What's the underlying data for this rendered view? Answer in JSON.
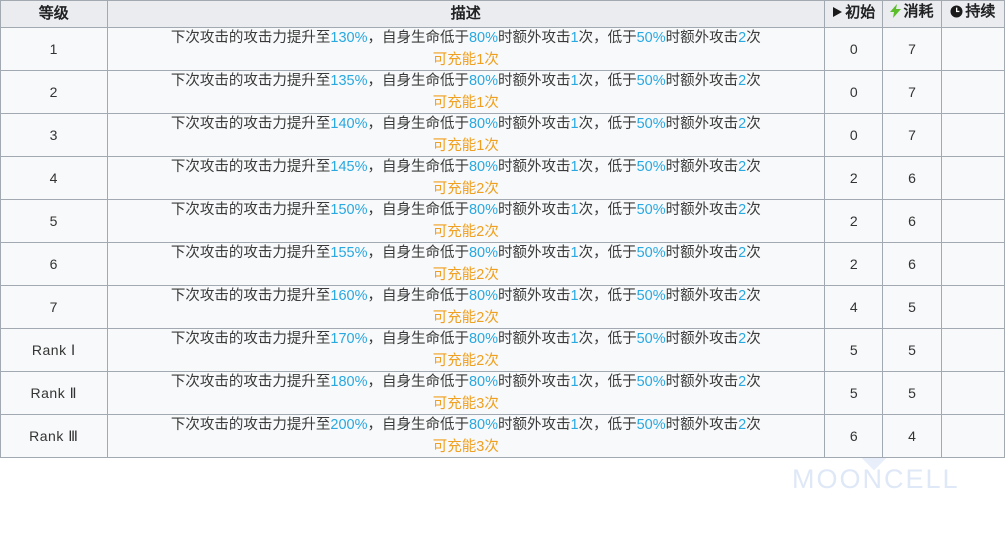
{
  "table": {
    "headers": {
      "level": "等级",
      "description": "描述",
      "initial": "初始",
      "cost": "消耗",
      "duration": "持续"
    },
    "header_icons": {
      "initial": "play-triangle-icon",
      "cost": "lightning-bolt-icon",
      "duration": "clock-icon"
    },
    "colors": {
      "highlight": "#29a8e0",
      "charge": "#f0a020",
      "header_bg": "#eaecf0",
      "row_bg": "#f8f9fa",
      "border": "#a2a9b1",
      "watermark": "#dfe8f7"
    },
    "rows": [
      {
        "level": "1",
        "desc_prefix": "下次攻击的攻击力提升至",
        "atk": "130%",
        "desc_mid1": "，自身生命低于",
        "hp1": "80%",
        "desc_mid2": "时额外攻击",
        "extra1": "1",
        "desc_mid3": "次，低于",
        "hp2": "50%",
        "desc_mid4": "时额外攻击",
        "extra2": "2",
        "desc_suffix": "次",
        "charge": "可充能1次",
        "initial": "0",
        "cost": "7",
        "duration": ""
      },
      {
        "level": "2",
        "desc_prefix": "下次攻击的攻击力提升至",
        "atk": "135%",
        "desc_mid1": "，自身生命低于",
        "hp1": "80%",
        "desc_mid2": "时额外攻击",
        "extra1": "1",
        "desc_mid3": "次，低于",
        "hp2": "50%",
        "desc_mid4": "时额外攻击",
        "extra2": "2",
        "desc_suffix": "次",
        "charge": "可充能1次",
        "initial": "0",
        "cost": "7",
        "duration": ""
      },
      {
        "level": "3",
        "desc_prefix": "下次攻击的攻击力提升至",
        "atk": "140%",
        "desc_mid1": "，自身生命低于",
        "hp1": "80%",
        "desc_mid2": "时额外攻击",
        "extra1": "1",
        "desc_mid3": "次，低于",
        "hp2": "50%",
        "desc_mid4": "时额外攻击",
        "extra2": "2",
        "desc_suffix": "次",
        "charge": "可充能1次",
        "initial": "0",
        "cost": "7",
        "duration": ""
      },
      {
        "level": "4",
        "desc_prefix": "下次攻击的攻击力提升至",
        "atk": "145%",
        "desc_mid1": "，自身生命低于",
        "hp1": "80%",
        "desc_mid2": "时额外攻击",
        "extra1": "1",
        "desc_mid3": "次，低于",
        "hp2": "50%",
        "desc_mid4": "时额外攻击",
        "extra2": "2",
        "desc_suffix": "次",
        "charge": "可充能2次",
        "initial": "2",
        "cost": "6",
        "duration": ""
      },
      {
        "level": "5",
        "desc_prefix": "下次攻击的攻击力提升至",
        "atk": "150%",
        "desc_mid1": "，自身生命低于",
        "hp1": "80%",
        "desc_mid2": "时额外攻击",
        "extra1": "1",
        "desc_mid3": "次，低于",
        "hp2": "50%",
        "desc_mid4": "时额外攻击",
        "extra2": "2",
        "desc_suffix": "次",
        "charge": "可充能2次",
        "initial": "2",
        "cost": "6",
        "duration": ""
      },
      {
        "level": "6",
        "desc_prefix": "下次攻击的攻击力提升至",
        "atk": "155%",
        "desc_mid1": "，自身生命低于",
        "hp1": "80%",
        "desc_mid2": "时额外攻击",
        "extra1": "1",
        "desc_mid3": "次，低于",
        "hp2": "50%",
        "desc_mid4": "时额外攻击",
        "extra2": "2",
        "desc_suffix": "次",
        "charge": "可充能2次",
        "initial": "2",
        "cost": "6",
        "duration": ""
      },
      {
        "level": "7",
        "desc_prefix": "下次攻击的攻击力提升至",
        "atk": "160%",
        "desc_mid1": "，自身生命低于",
        "hp1": "80%",
        "desc_mid2": "时额外攻击",
        "extra1": "1",
        "desc_mid3": "次，低于",
        "hp2": "50%",
        "desc_mid4": "时额外攻击",
        "extra2": "2",
        "desc_suffix": "次",
        "charge": "可充能2次",
        "initial": "4",
        "cost": "5",
        "duration": ""
      },
      {
        "level": "Rank Ⅰ",
        "desc_prefix": "下次攻击的攻击力提升至",
        "atk": "170%",
        "desc_mid1": "，自身生命低于",
        "hp1": "80%",
        "desc_mid2": "时额外攻击",
        "extra1": "1",
        "desc_mid3": "次，低于",
        "hp2": "50%",
        "desc_mid4": "时额外攻击",
        "extra2": "2",
        "desc_suffix": "次",
        "charge": "可充能2次",
        "initial": "5",
        "cost": "5",
        "duration": ""
      },
      {
        "level": "Rank Ⅱ",
        "desc_prefix": "下次攻击的攻击力提升至",
        "atk": "180%",
        "desc_mid1": "，自身生命低于",
        "hp1": "80%",
        "desc_mid2": "时额外攻击",
        "extra1": "1",
        "desc_mid3": "次，低于",
        "hp2": "50%",
        "desc_mid4": "时额外攻击",
        "extra2": "2",
        "desc_suffix": "次",
        "charge": "可充能3次",
        "initial": "5",
        "cost": "5",
        "duration": ""
      },
      {
        "level": "Rank Ⅲ",
        "desc_prefix": "下次攻击的攻击力提升至",
        "atk": "200%",
        "desc_mid1": "，自身生命低于",
        "hp1": "80%",
        "desc_mid2": "时额外攻击",
        "extra1": "1",
        "desc_mid3": "次，低于",
        "hp2": "50%",
        "desc_mid4": "时额外攻击",
        "extra2": "2",
        "desc_suffix": "次",
        "charge": "可充能3次",
        "initial": "6",
        "cost": "4",
        "duration": ""
      }
    ]
  },
  "watermark": {
    "text": "MOONCELL",
    "logo": "diamond-logo-icon"
  }
}
